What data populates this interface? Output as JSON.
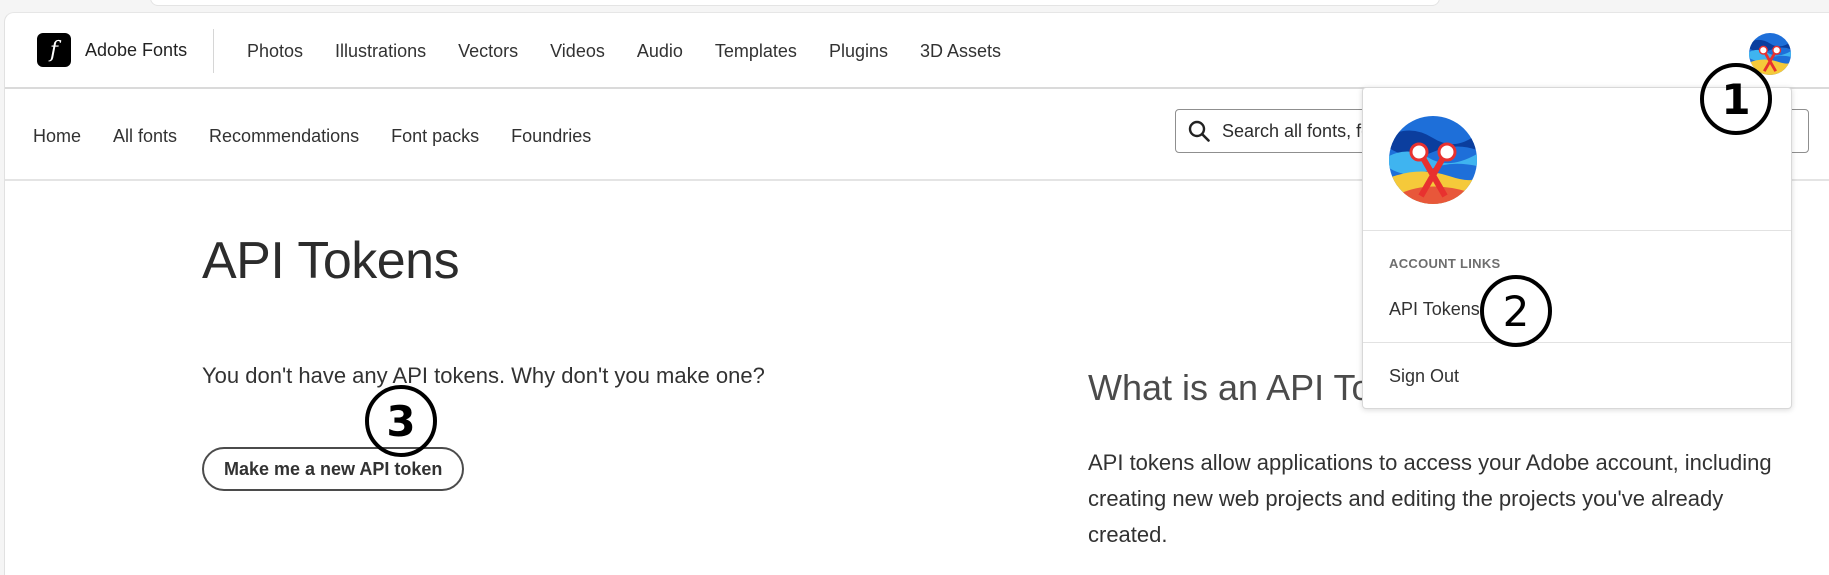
{
  "brand": {
    "name": "Adobe Fonts",
    "logo_glyph": "f"
  },
  "global_nav": [
    "Photos",
    "Illustrations",
    "Vectors",
    "Videos",
    "Audio",
    "Templates",
    "Plugins",
    "3D Assets"
  ],
  "sub_nav": [
    "Home",
    "All fonts",
    "Recommendations",
    "Font packs",
    "Foundries"
  ],
  "search": {
    "value": "Search all fonts, fo",
    "icon": "search-icon"
  },
  "main": {
    "title": "API Tokens",
    "empty_message": "You don't have any API tokens. Why don't you make one?",
    "make_button": "Make me a new API token"
  },
  "info": {
    "heading": "What is an API Tok",
    "body": "API tokens allow applications to access your Adobe account, including creating new web projects and editing the projects you've already created."
  },
  "account_menu": {
    "section_heading": "ACCOUNT LINKS",
    "api_tokens": "API Tokens",
    "sign_out": "Sign Out"
  },
  "annotations": {
    "step1": "1",
    "step2": "2",
    "step3": "3"
  },
  "colors": {
    "brand_logo_bg": "#000000",
    "text": "#2c2c2c",
    "avatar_bg": "#1e6fd9",
    "avatar_accent": "#e8312f"
  }
}
